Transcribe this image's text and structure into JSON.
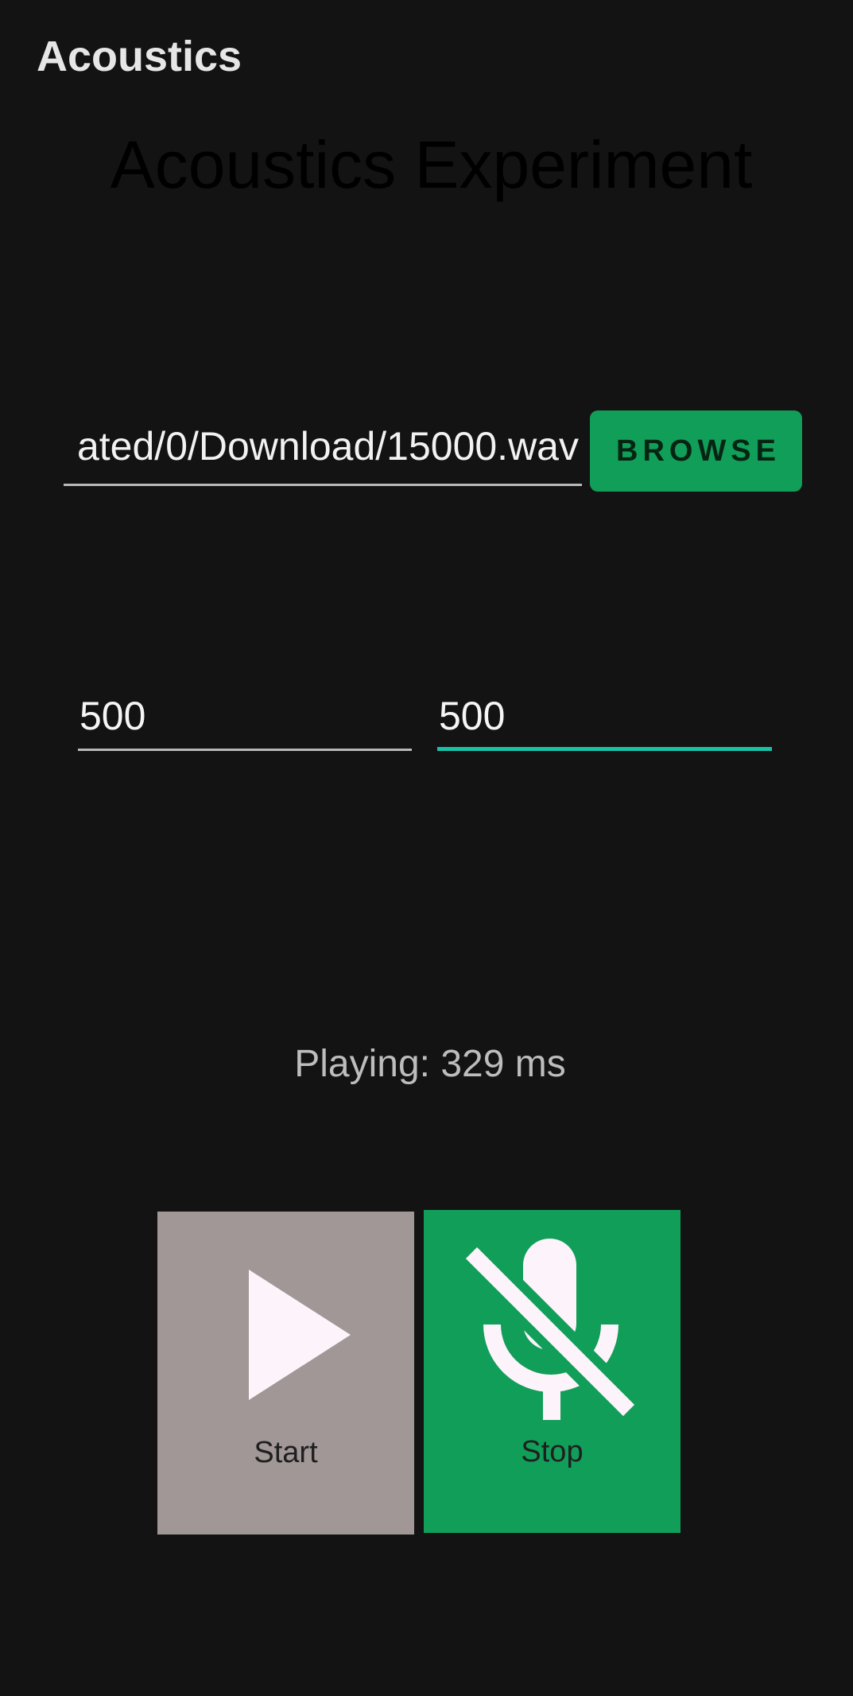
{
  "app_bar": {
    "title": "Acoustics"
  },
  "headline": "Acoustics Experiment",
  "file_picker": {
    "path_value": "ated/0/Download/15000.wav",
    "browse_label": "BROWSE"
  },
  "params": {
    "left_value": "500",
    "right_value": "500"
  },
  "status_text": "Playing: 329 ms",
  "controls": {
    "start_label": "Start",
    "stop_label": "Stop"
  },
  "colors": {
    "background": "#131313",
    "accent_green": "#119e59",
    "focus_teal": "#19c0a6",
    "start_button": "#a09796",
    "icon_fill": "#fdf3fb"
  },
  "icons": {
    "start": "play-icon",
    "stop": "mic-off-icon"
  }
}
